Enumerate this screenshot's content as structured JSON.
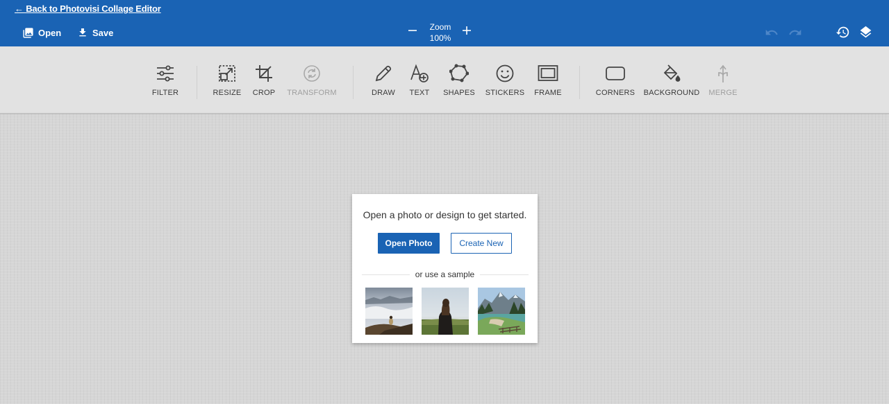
{
  "topbar": {
    "back_link": "← Back to Photovisi Collage Editor",
    "open_label": "Open",
    "save_label": "Save",
    "zoom_label": "Zoom",
    "zoom_value": "100%",
    "icons": [
      "image-icon",
      "download-icon",
      "minus-icon",
      "plus-icon",
      "undo-icon",
      "redo-icon",
      "history-icon",
      "layers-icon"
    ],
    "accent_color": "#1a63b4"
  },
  "toolbar": {
    "tools": [
      {
        "label": "FILTER",
        "icon": "sliders-icon",
        "enabled": true
      },
      {
        "label": "RESIZE",
        "icon": "resize-icon",
        "enabled": true
      },
      {
        "label": "CROP",
        "icon": "crop-icon",
        "enabled": true
      },
      {
        "label": "TRANSFORM",
        "icon": "rotate-icon",
        "enabled": false
      },
      {
        "label": "DRAW",
        "icon": "pencil-icon",
        "enabled": true
      },
      {
        "label": "TEXT",
        "icon": "text-add-icon",
        "enabled": true
      },
      {
        "label": "SHAPES",
        "icon": "polygon-icon",
        "enabled": true
      },
      {
        "label": "STICKERS",
        "icon": "smiley-icon",
        "enabled": true
      },
      {
        "label": "FRAME",
        "icon": "frame-icon",
        "enabled": true
      },
      {
        "label": "CORNERS",
        "icon": "rounded-rect-icon",
        "enabled": true
      },
      {
        "label": "BACKGROUND",
        "icon": "paint-bucket-icon",
        "enabled": true
      },
      {
        "label": "MERGE",
        "icon": "merge-icon",
        "enabled": false
      }
    ]
  },
  "card": {
    "message": "Open a photo or design to get started.",
    "open_photo": "Open Photo",
    "create_new": "Create New",
    "or_sample": "or use a sample",
    "samples": [
      "sample-photo-fog",
      "sample-photo-girl",
      "sample-photo-lake"
    ]
  }
}
